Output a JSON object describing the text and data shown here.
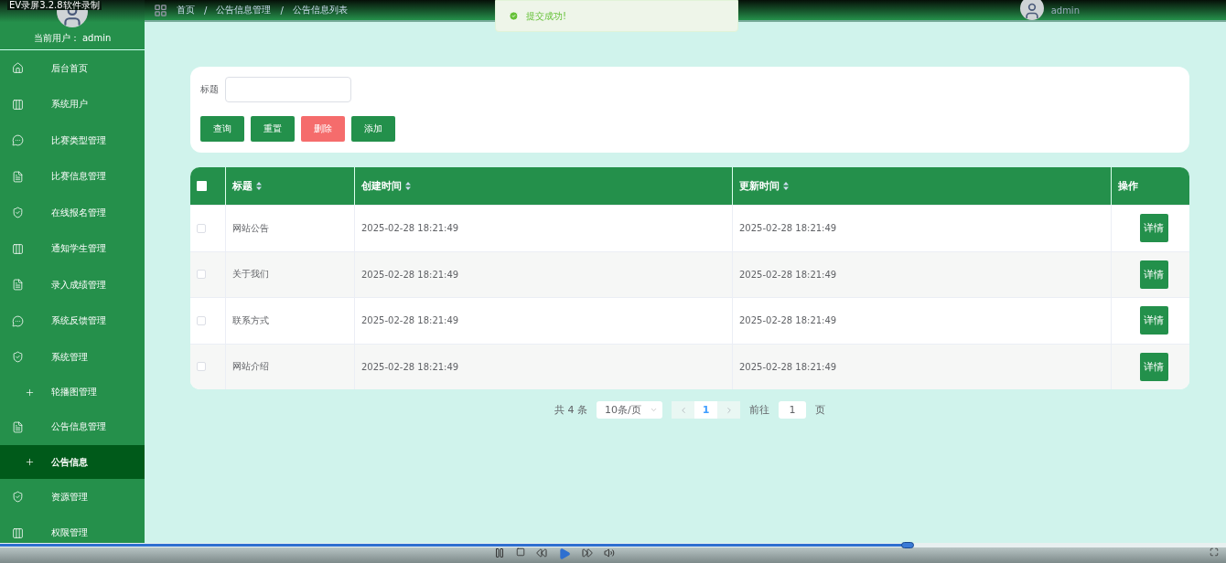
{
  "recorder_title": "EV录屏3.2.8软件录制",
  "sidebar": {
    "current_user_label": "当前用户：",
    "current_user": "admin",
    "items": [
      {
        "label": "后台首页",
        "kind": "menu",
        "selected": false
      },
      {
        "label": "系统用户",
        "kind": "menu",
        "selected": false
      },
      {
        "label": "比赛类型管理",
        "kind": "menu",
        "selected": false
      },
      {
        "label": "比赛信息管理",
        "kind": "menu",
        "selected": false
      },
      {
        "label": "在线报名管理",
        "kind": "menu",
        "selected": false
      },
      {
        "label": "通知学生管理",
        "kind": "menu",
        "selected": false
      },
      {
        "label": "录入成绩管理",
        "kind": "menu",
        "selected": false
      },
      {
        "label": "系统反馈管理",
        "kind": "menu",
        "selected": false
      },
      {
        "label": "系统管理",
        "kind": "menu",
        "selected": false
      },
      {
        "label": "轮播图管理",
        "kind": "submenu",
        "selected": false
      },
      {
        "label": "公告信息管理",
        "kind": "menu",
        "selected": false
      },
      {
        "label": "公告信息",
        "kind": "submenu",
        "selected": true
      },
      {
        "label": "资源管理",
        "kind": "menu",
        "selected": false
      },
      {
        "label": "权限管理",
        "kind": "menu",
        "selected": false
      }
    ]
  },
  "header": {
    "breadcrumb": [
      "首页",
      "/",
      "公告信息管理",
      "/",
      "公告信息列表"
    ],
    "user": "admin"
  },
  "toast": {
    "message": "提交成功!"
  },
  "search": {
    "label": "标题",
    "buttons": [
      {
        "label": "查询",
        "kind": "primary"
      },
      {
        "label": "重置",
        "kind": "primary"
      },
      {
        "label": "删除",
        "kind": "danger"
      },
      {
        "label": "添加",
        "kind": "primary"
      }
    ]
  },
  "table": {
    "header_checked": false,
    "columns": [
      {
        "label": "标题",
        "sortable": true
      },
      {
        "label": "创建时间",
        "sortable": true
      },
      {
        "label": "更新时间",
        "sortable": true
      },
      {
        "label": "操作",
        "sortable": false
      }
    ],
    "rows": [
      {
        "checked": false,
        "title": "网站公告",
        "created": "2025-02-28 18:21:49",
        "updated": "2025-02-28 18:21:49",
        "action": "详情"
      },
      {
        "checked": false,
        "title": "关于我们",
        "created": "2025-02-28 18:21:49",
        "updated": "2025-02-28 18:21:49",
        "action": "详情"
      },
      {
        "checked": false,
        "title": "联系方式",
        "created": "2025-02-28 18:21:49",
        "updated": "2025-02-28 18:21:49",
        "action": "详情"
      },
      {
        "checked": false,
        "title": "网站介绍",
        "created": "2025-02-28 18:21:49",
        "updated": "2025-02-28 18:21:49",
        "action": "详情"
      }
    ]
  },
  "pagination": {
    "total": "共 4 条",
    "page_size": "10条/页",
    "pages": [
      {
        "label": "1",
        "selected": true
      }
    ],
    "goto_label": "前往",
    "goto_value": "1",
    "goto_suffix": "页"
  },
  "player": {
    "level": 0.74
  }
}
